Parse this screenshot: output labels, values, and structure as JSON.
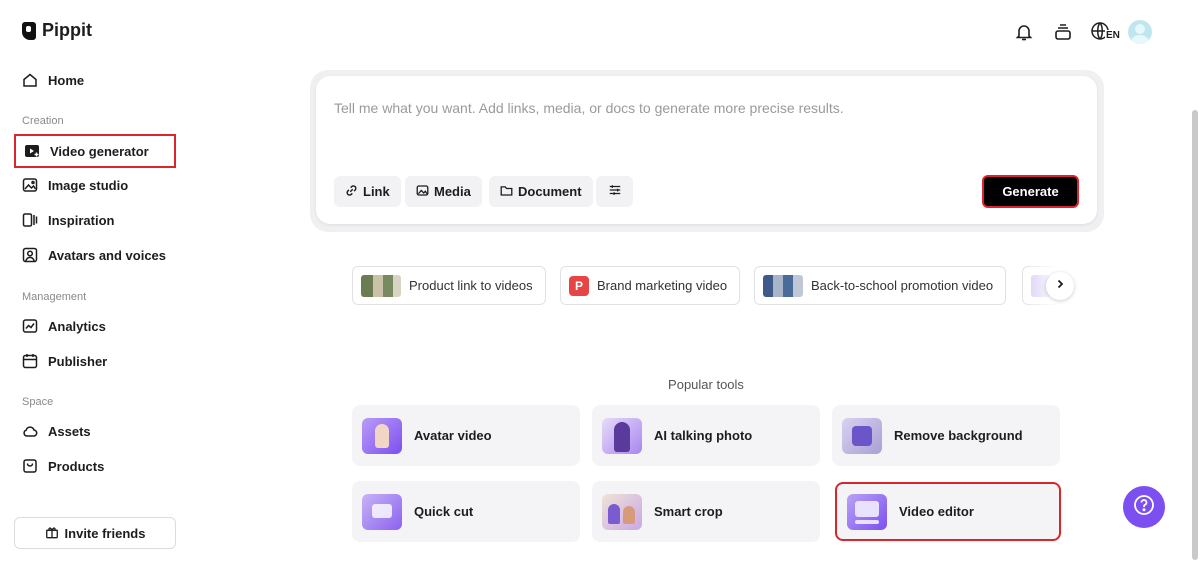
{
  "brand": {
    "name": "Pippit"
  },
  "sidebar": {
    "home": "Home",
    "sections": [
      {
        "title": "Creation"
      },
      {
        "title": "Management"
      },
      {
        "title": "Space"
      }
    ],
    "items": [
      {
        "label": "Video generator"
      },
      {
        "label": "Image studio"
      },
      {
        "label": "Inspiration"
      },
      {
        "label": "Avatars and voices"
      },
      {
        "label": "Analytics"
      },
      {
        "label": "Publisher"
      },
      {
        "label": "Assets"
      },
      {
        "label": "Products"
      }
    ],
    "invite": "Invite friends"
  },
  "header": {
    "language": "EN"
  },
  "prompt": {
    "placeholder": "Tell me what you want. Add links, media, or docs to generate more precise results.",
    "chips": [
      "Link",
      "Media",
      "Document"
    ],
    "generate": "Generate"
  },
  "suggestions": [
    {
      "label": "Product link to videos"
    },
    {
      "label": "Brand marketing video",
      "badge": "P"
    },
    {
      "label": "Back-to-school promotion video"
    }
  ],
  "popular": {
    "title": "Popular tools",
    "tools": [
      {
        "label": "Avatar video"
      },
      {
        "label": "AI talking photo"
      },
      {
        "label": "Remove background"
      },
      {
        "label": "Quick cut"
      },
      {
        "label": "Smart crop"
      },
      {
        "label": "Video editor"
      }
    ]
  },
  "colors": {
    "accent": "#7c4ff0",
    "highlight": "#d9262c"
  }
}
